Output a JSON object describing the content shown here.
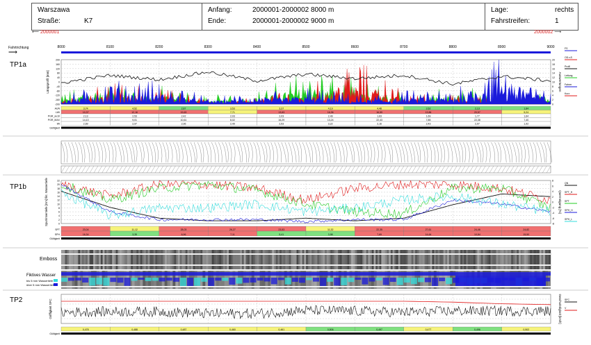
{
  "header": {
    "city": "Warszawa",
    "street_label": "Straße:",
    "street_value": "K7",
    "start_label": "Anfang:",
    "start_value": "2000001-2000002  8000 m",
    "end_label": "Ende:",
    "end_value": "2000001-2000002  9000 m",
    "position_label": "Lage:",
    "position_value": "rechts",
    "lane_label": "Fahrstreifen:",
    "lane_value": "1"
  },
  "nav": {
    "left_id": "2000001",
    "right_id": "2000002",
    "direction_label": "Fahrtrichtung"
  },
  "sections": {
    "tp1a": "TP1a",
    "tp1b": "TP1b",
    "tp2": "TP2",
    "emboss": "Emboss",
    "water": "Fiktives Wasser",
    "water_legend_1": "bis 5 mm Wassertiefe",
    "water_legend_2": "über 5 mm Wassertiefe",
    "gueltigkeit": "Gültigkeit"
  },
  "axis": {
    "ticks": [
      "8000",
      "8100",
      "8200",
      "8300",
      "8400",
      "8500",
      "8600",
      "8700",
      "8800",
      "8900",
      "9000"
    ]
  },
  "tp1a_axis": {
    "left_label": "Längsprofil [mm]",
    "right_label": "Auswertungen",
    "left_ticks": [
      "200",
      "160",
      "120",
      "80",
      "40",
      "0",
      "-40",
      "-80",
      "-120",
      "-160",
      "-200"
    ],
    "right_ticks": [
      "20",
      "18",
      "16",
      "14",
      "12",
      "10",
      "8",
      "6",
      "4",
      "2",
      "0"
    ],
    "legend": [
      "FS",
      "OD.v.E.",
      "Profil",
      "Leitung",
      "Fahrer",
      "Kurz"
    ]
  },
  "tp1a_table": {
    "row_labels": [
      "AUN",
      "LWI",
      "PGR_av10",
      "PGR_MAX",
      "WI"
    ],
    "rows": [
      [
        "3,74",
        "4,52",
        "2,87",
        "3,53",
        "3,37",
        "4,19",
        "4,48",
        "2,62",
        "2,13",
        "1,84"
      ],
      [
        "10,37",
        "12,16",
        "19,63",
        "7,71",
        "13,63",
        "16,36",
        "16,59",
        "13,86",
        "20,57",
        "5,24"
      ],
      [
        "2,13",
        "2,53",
        "2,42",
        "2,03",
        "2,03",
        "2,49",
        "1,63",
        "1,69",
        "1,77",
        "1,64"
      ],
      [
        "14,10",
        "9,01",
        "10,61",
        "8,02",
        "16,29",
        "13,24",
        "22,43",
        "7,85",
        "22,38",
        "7,40"
      ],
      [
        "2,69",
        "2,97",
        "2,96",
        "2,49",
        "2,53",
        "3,22",
        "2,16",
        "2,43",
        "2,07",
        "1,92"
      ]
    ],
    "row_colors": [
      [
        "#f6f37a",
        "#f6f37a",
        "#7fe07f",
        "#f6f37a",
        "#f6f37a",
        "#f6f37a",
        "#f6f37a",
        "#7fe07f",
        "#7fe07f",
        "#7fe07f"
      ],
      [
        "#f07070",
        "#f07070",
        "#f07070",
        "#f6f37a",
        "#f07070",
        "#f07070",
        "#f07070",
        "#f07070",
        "#f07070",
        "#f6f37a"
      ]
    ]
  },
  "tp1b_axis": {
    "left_label": "Spurrinnentiefe [mm] fikt. Wassertiefe",
    "right_label": "Querneigung [%]",
    "left_ticks": [
      "22",
      "20",
      "18",
      "16",
      "14",
      "12",
      "10",
      "8",
      "6",
      "4",
      "2",
      "0"
    ],
    "right_ticks": [
      "8",
      "6",
      "4",
      "2",
      "0",
      "-2",
      "-4",
      "-6",
      "-8"
    ],
    "legend": [
      "QN",
      "SPT_H",
      "SPT",
      "SPH_H",
      "SPH_L"
    ]
  },
  "tp1b_table": {
    "row_labels": [
      "SPT",
      "SPH"
    ],
    "rows": [
      [
        "23,04",
        "11,12",
        "28,03",
        "26,27",
        "23,53",
        "11,32",
        "22,35",
        "27,61",
        "24,46",
        "24,82"
      ],
      [
        "16,34",
        "3,35",
        "6,96",
        "7,11",
        "5,41",
        "3,98",
        "7,69",
        "14,64",
        "10,84",
        "15,50"
      ]
    ],
    "row_colors": [
      [
        "#f07070",
        "#f6f37a",
        "#f07070",
        "#f07070",
        "#f07070",
        "#f6f37a",
        "#f07070",
        "#f07070",
        "#f07070",
        "#f07070"
      ],
      [
        "#f07070",
        "#7fe07f",
        "#f07070",
        "#f07070",
        "#7fe07f",
        "#7fe07f",
        "#f07070",
        "#f07070",
        "#f07070",
        "#f07070"
      ]
    ]
  },
  "tp2_axis": {
    "left_label": "Griffigkeit SFC",
    "right_label": "Geschwindigkeit [km/h]",
    "legend": [
      "SFC",
      "V"
    ]
  },
  "tp2_table": {
    "row_labels": [
      ""
    ],
    "rows": [
      [
        "0,478",
        "0,488",
        "0,487",
        "0,460",
        "0,461",
        "0,506",
        "0,497",
        "0,477",
        "0,496",
        "0,502"
      ]
    ],
    "row_colors": [
      [
        "#f6f37a",
        "#f6f37a",
        "#f6f37a",
        "#f6f37a",
        "#f6f37a",
        "#7fe07f",
        "#7fe07f",
        "#f6f37a",
        "#7fe07f",
        "#f6f37a"
      ]
    ]
  },
  "colors": {
    "grid": "#bbbbbb",
    "blue": "#1a1adb",
    "red": "#e01a1a",
    "green": "#22cc22",
    "cyan": "#33dddd",
    "black": "#111111",
    "yellow_cell": "#f6f37a",
    "green_cell": "#7fe07f",
    "red_cell": "#f07070"
  },
  "chart_data": [
    {
      "type": "line",
      "name": "TP1a",
      "x": [
        8000,
        8100,
        8200,
        8300,
        8400,
        8500,
        8600,
        8700,
        8800,
        8900,
        9000
      ],
      "series": [
        {
          "name": "Profil",
          "values": [
            -10,
            60,
            20,
            90,
            10,
            70,
            30,
            60,
            -20,
            50,
            10
          ]
        },
        {
          "name": "Leitung",
          "values": [
            -120,
            -40,
            -70,
            -140,
            -120,
            60,
            -40,
            -120,
            -50,
            -150,
            -120
          ]
        },
        {
          "name": "Fahrer",
          "values": [
            -150,
            -50,
            -40,
            -150,
            -130,
            -80,
            -140,
            -110,
            -100,
            180,
            -130
          ]
        },
        {
          "name": "Kurz",
          "values": [
            -160,
            -60,
            -80,
            -170,
            -150,
            -100,
            110,
            -120,
            -140,
            -160,
            -150
          ]
        }
      ],
      "ylim": [
        -200,
        200
      ]
    },
    {
      "type": "line",
      "name": "TP1b",
      "x": [
        8000,
        8100,
        8200,
        8300,
        8400,
        8500,
        8600,
        8700,
        8800,
        8900,
        9000
      ],
      "series": [
        {
          "name": "QN",
          "values": [
            4,
            -2,
            -6,
            -7,
            -7,
            -6,
            -7,
            -6,
            -1,
            3,
            2
          ]
        },
        {
          "name": "SPT_H",
          "values": [
            20,
            14,
            20,
            20,
            18,
            12,
            18,
            20,
            20,
            18,
            12
          ]
        },
        {
          "name": "SPT",
          "values": [
            20,
            12,
            18,
            20,
            17,
            10,
            6,
            5,
            18,
            18,
            8
          ]
        },
        {
          "name": "SPH_H",
          "values": [
            20,
            6,
            2,
            2,
            2,
            1,
            2,
            2,
            12,
            10,
            6
          ]
        },
        {
          "name": "SPH_L",
          "values": [
            16,
            4,
            8,
            8,
            10,
            6,
            8,
            12,
            14,
            10,
            6
          ]
        }
      ],
      "ylim": [
        0,
        22
      ]
    },
    {
      "type": "line",
      "name": "TP2",
      "x": [
        8000,
        8100,
        8200,
        8300,
        8400,
        8500,
        8600,
        8700,
        8800,
        8900,
        9000
      ],
      "series": [
        {
          "name": "SFC",
          "values": [
            0.48,
            0.49,
            0.49,
            0.46,
            0.46,
            0.51,
            0.5,
            0.48,
            0.5,
            0.5,
            0.5
          ]
        },
        {
          "name": "V",
          "values": [
            80,
            80,
            80,
            80,
            80,
            80,
            80,
            80,
            79,
            77,
            76
          ]
        }
      ]
    }
  ]
}
